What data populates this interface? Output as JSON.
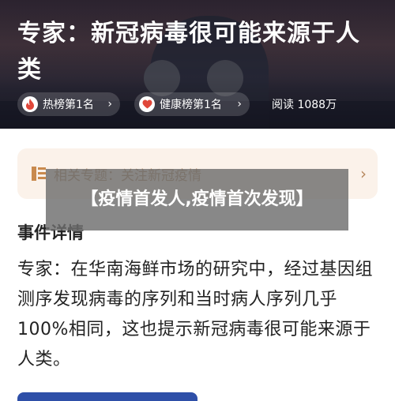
{
  "hero": {
    "title": "专家：新冠病毒很可能来源于人类",
    "chips": [
      {
        "icon": "fire-icon",
        "label": "热榜第1名"
      },
      {
        "icon": "heart-icon",
        "label": "健康榜第1名"
      }
    ],
    "read_label": "阅读 1088万",
    "colors": {
      "fire": "#e0473a",
      "heart": "#e0473a"
    }
  },
  "topic_bar": {
    "icon": "list-icon",
    "text": "相关专题：关注新冠疫情",
    "accent": "#b7895f"
  },
  "section": {
    "title": "事件详情",
    "detail": "专家：在华南海鲜市场的研究中，经过基因组测序发现病毒的序列和当时病人序列几乎100%相同，这也提示新冠病毒很可能来源于人类。"
  },
  "overlay": {
    "headline": "【疫情首发人,疫情首次发现】"
  }
}
